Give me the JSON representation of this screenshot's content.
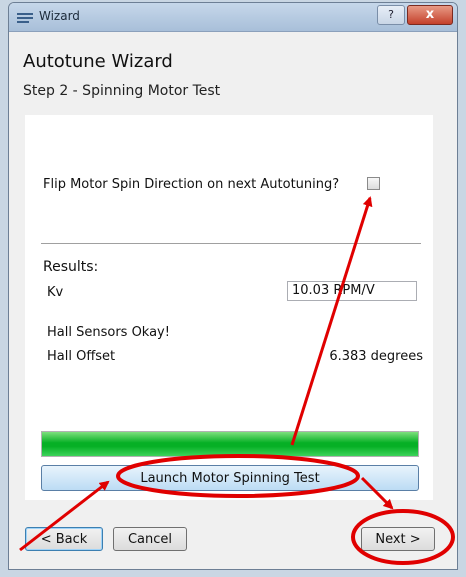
{
  "window": {
    "title": "Wizard",
    "help_label": "?",
    "close_label": "x"
  },
  "wizard": {
    "title": "Autotune Wizard",
    "step": "Step 2 - Spinning Motor Test"
  },
  "panel": {
    "flip_label": "Flip Motor Spin Direction on next Autotuning?",
    "flip_checked": false,
    "results_label": "Results:",
    "kv_label": "Kv",
    "kv_value": "10.03 RPM/V",
    "hall_status": "Hall Sensors Okay!",
    "hall_offset_label": "Hall Offset",
    "hall_offset_value": "6.383 degrees",
    "progress_fraction": 1.0,
    "launch_label": "Launch Motor Spinning Test"
  },
  "footer": {
    "back_label": "< Back",
    "cancel_label": "Cancel",
    "next_label": "Next >"
  },
  "colors": {
    "annotation": "#e00000",
    "progress": "#06b025"
  }
}
